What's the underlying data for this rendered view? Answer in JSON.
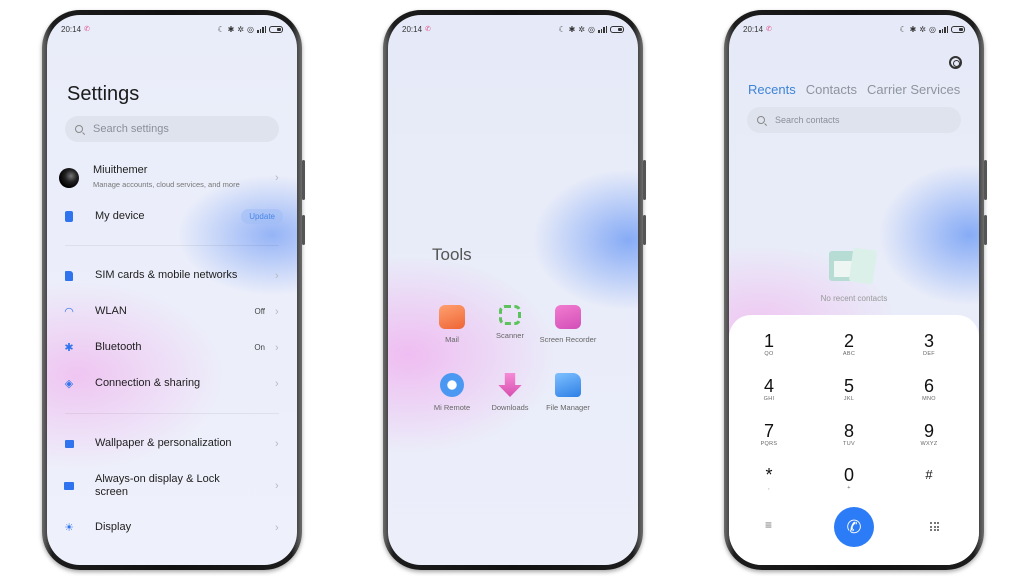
{
  "status_bar": {
    "time": "20:14"
  },
  "settings": {
    "title": "Settings",
    "search_placeholder": "Search settings",
    "account": {
      "name": "Miuithemer",
      "subtitle": "Manage accounts, cloud services, and more"
    },
    "my_device": {
      "label": "My device",
      "badge": "Update"
    },
    "items": [
      {
        "label": "SIM cards & mobile networks",
        "value": "",
        "icon": "sim-card-icon"
      },
      {
        "label": "WLAN",
        "value": "Off",
        "icon": "wifi-icon"
      },
      {
        "label": "Bluetooth",
        "value": "On",
        "icon": "bluetooth-icon"
      },
      {
        "label": "Connection & sharing",
        "value": "",
        "icon": "connection-sharing-icon"
      },
      {
        "label": "Wallpaper & personalization",
        "value": "",
        "icon": "wallpaper-icon"
      },
      {
        "label": "Always-on display & Lock screen",
        "value": "",
        "icon": "lock-icon"
      },
      {
        "label": "Display",
        "value": "",
        "icon": "display-brightness-icon"
      }
    ]
  },
  "tools": {
    "title": "Tools",
    "apps": [
      {
        "label": "Mail",
        "icon": "mail-icon",
        "color": "#f07a45"
      },
      {
        "label": "Scanner",
        "icon": "scanner-icon",
        "color": "#5cc25c"
      },
      {
        "label": "Screen Recorder",
        "icon": "screen-recorder-icon",
        "color": "#e060c8"
      },
      {
        "label": "Mi Remote",
        "icon": "mi-remote-icon",
        "color": "#3f8ef0"
      },
      {
        "label": "Downloads",
        "icon": "downloads-icon",
        "color": "#e058b8"
      },
      {
        "label": "File Manager",
        "icon": "file-manager-icon",
        "color": "#3f8ef0"
      }
    ]
  },
  "dialer": {
    "tabs": [
      {
        "label": "Recents",
        "active": true
      },
      {
        "label": "Contacts",
        "active": false
      },
      {
        "label": "Carrier Services",
        "active": false
      }
    ],
    "search_placeholder": "Search contacts",
    "empty_text": "No recent contacts",
    "keys": [
      {
        "num": "1",
        "letters": "QO"
      },
      {
        "num": "2",
        "letters": "ABC"
      },
      {
        "num": "3",
        "letters": "DEF"
      },
      {
        "num": "4",
        "letters": "GHI"
      },
      {
        "num": "5",
        "letters": "JKL"
      },
      {
        "num": "6",
        "letters": "MNO"
      },
      {
        "num": "7",
        "letters": "PQRS"
      },
      {
        "num": "8",
        "letters": "TUV"
      },
      {
        "num": "9",
        "letters": "WXYZ"
      },
      {
        "num": "*",
        "letters": ","
      },
      {
        "num": "0",
        "letters": "+"
      },
      {
        "num": "#",
        "letters": ""
      }
    ],
    "call_color": "#2b7cf6"
  }
}
